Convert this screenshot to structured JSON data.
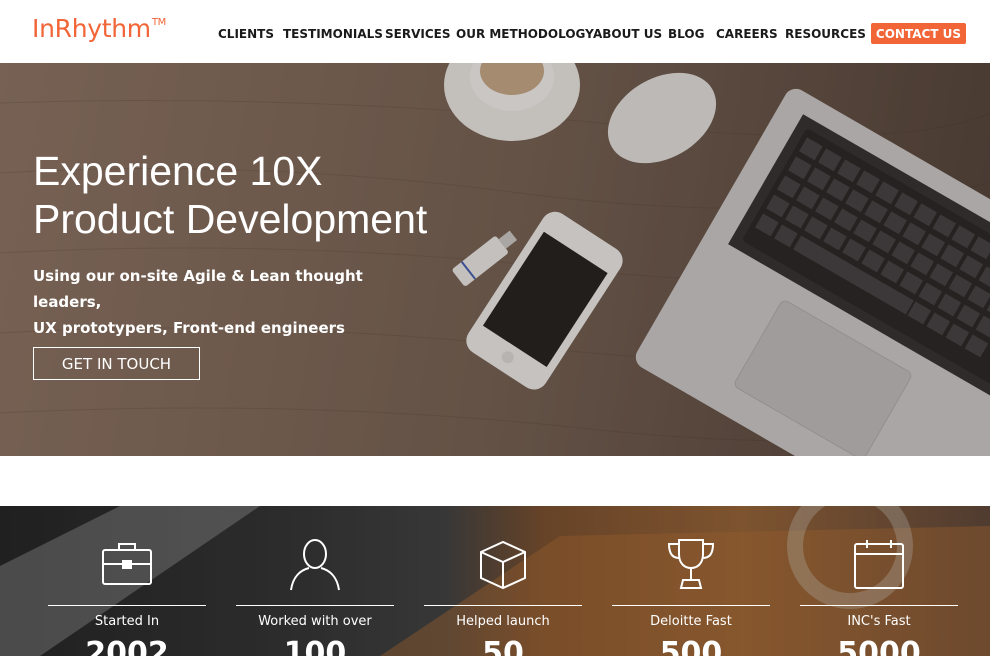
{
  "brand": {
    "name": "InRhythm",
    "tm": "TM"
  },
  "nav": {
    "items": [
      {
        "label": "CLIENTS"
      },
      {
        "label": "TESTIMONIALS"
      },
      {
        "label": "SERVICES"
      },
      {
        "label": "OUR METHODOLOGY"
      },
      {
        "label": "ABOUT US"
      },
      {
        "label": "BLOG"
      },
      {
        "label": "CAREERS"
      },
      {
        "label": "RESOURCES"
      }
    ],
    "contact_label": "CONTACT US"
  },
  "hero": {
    "title_line1": "Experience 10X",
    "title_line2": "Product Development",
    "subtitle_line1": "Using our on-site Agile & Lean thought leaders,",
    "subtitle_line2": "UX prototypers, Front-end engineers",
    "cta_label": "GET IN TOUCH"
  },
  "stats": [
    {
      "icon": "briefcase-icon",
      "label": "Started In",
      "value": "2002"
    },
    {
      "icon": "person-icon",
      "label": "Worked with over",
      "value": "100"
    },
    {
      "icon": "box-icon",
      "label": "Helped launch",
      "value": "50"
    },
    {
      "icon": "trophy-icon",
      "label": "Deloitte Fast",
      "value": "500"
    },
    {
      "icon": "calendar-icon",
      "label": "INC's Fast",
      "value": "5000"
    }
  ],
  "colors": {
    "accent": "#f26537",
    "nav_text": "#1a1a1a",
    "hero_text": "#ffffff"
  }
}
